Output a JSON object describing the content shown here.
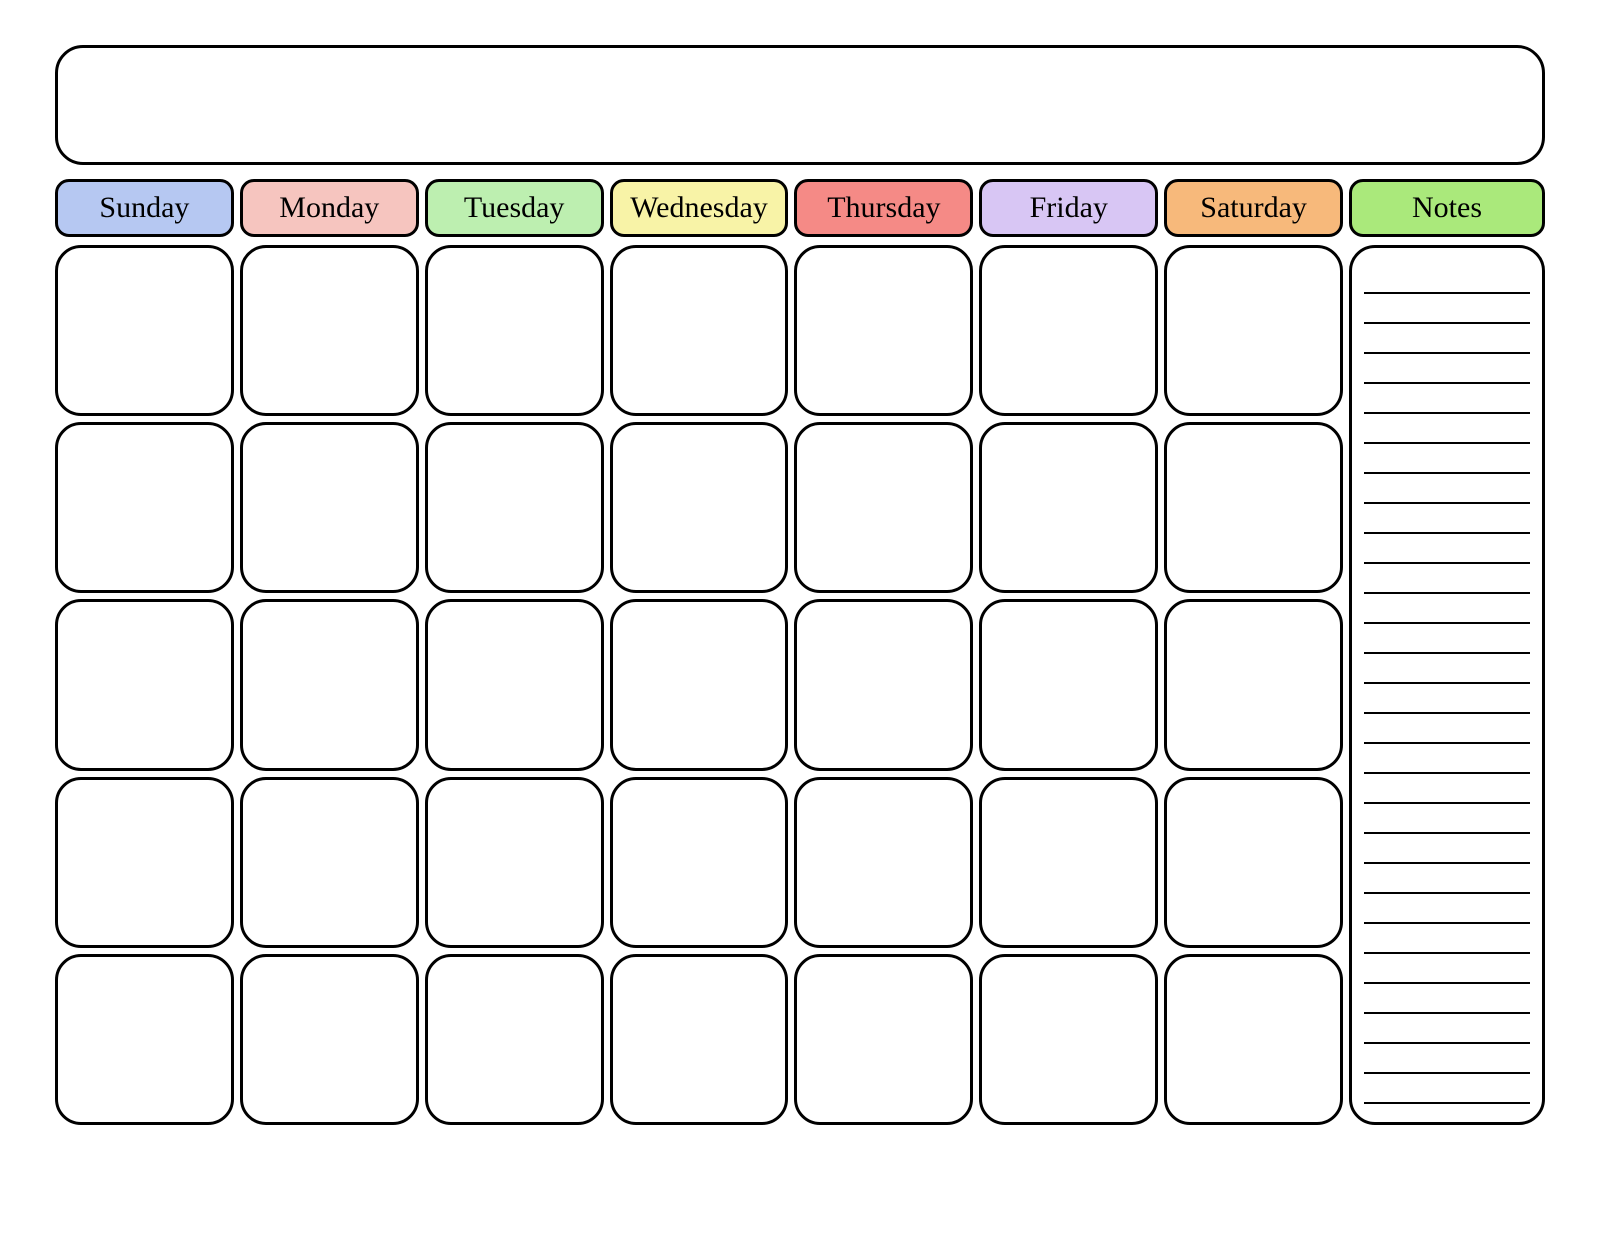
{
  "calendar": {
    "days": [
      {
        "label": "Sunday",
        "color": "#b6c8f2"
      },
      {
        "label": "Monday",
        "color": "#f6c5bf"
      },
      {
        "label": "Tuesday",
        "color": "#bdefb0"
      },
      {
        "label": "Wednesday",
        "color": "#f8f3a7"
      },
      {
        "label": "Thursday",
        "color": "#f58a86"
      },
      {
        "label": "Friday",
        "color": "#d8c6f4"
      },
      {
        "label": "Saturday",
        "color": "#f7b97b"
      }
    ],
    "notes": {
      "label": "Notes",
      "color": "#aae97b",
      "line_count": 28
    },
    "weeks": 5,
    "title": ""
  }
}
